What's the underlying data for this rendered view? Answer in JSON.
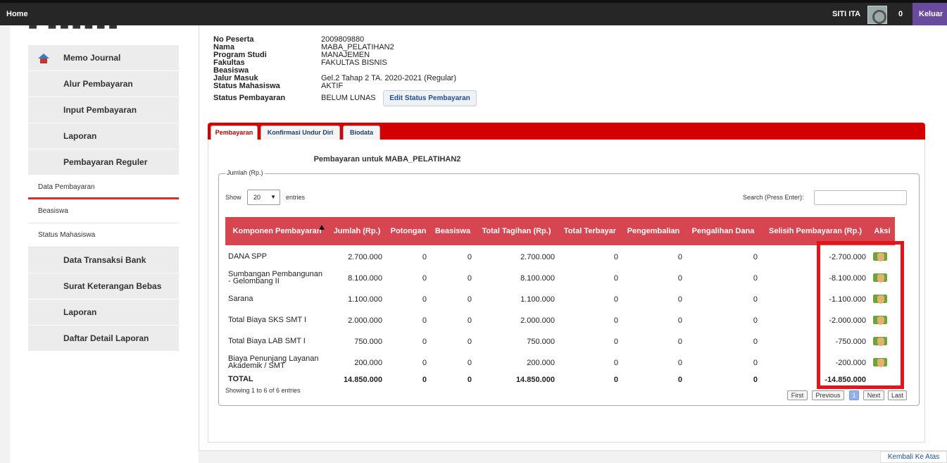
{
  "topbar": {
    "home": "Home",
    "user": "SITI ITA",
    "notif_count": "0",
    "logout": "Keluar"
  },
  "menu": {
    "items": [
      {
        "label": "Memo Journal",
        "icon": "home-icon",
        "type": "main"
      },
      {
        "label": "Alur Pembayaran",
        "type": "main"
      },
      {
        "label": "Input Pembayaran",
        "type": "main"
      },
      {
        "label": "Laporan",
        "type": "main"
      },
      {
        "label": "Pembayaran Reguler",
        "type": "main"
      },
      {
        "label": "Data Pembayaran",
        "type": "sub",
        "active": true
      },
      {
        "label": "Beasiswa",
        "type": "sub"
      },
      {
        "label": "Status Mahasiswa",
        "type": "sub"
      },
      {
        "label": "Data Transaksi Bank",
        "type": "main"
      },
      {
        "label": "Surat Keterangan Bebas",
        "type": "main"
      },
      {
        "label": "Laporan",
        "type": "main"
      },
      {
        "label": "Daftar Detail Laporan",
        "type": "main"
      }
    ]
  },
  "student": {
    "labels": [
      "No Peserta",
      "Nama",
      "Program Studi",
      "Fakultas",
      "Beasiswa",
      "Jalur Masuk",
      "Status Mahasiswa"
    ],
    "values": [
      "2009809880",
      "MABA_PELATIHAN2",
      "MANAJEMEN",
      "FAKULTAS BISNIS",
      "",
      "Gel.2 Tahap 2 TA. 2020-2021 (Regular)",
      "AKTIF"
    ],
    "status_label": "Status Pembayaran",
    "status_value": "BELUM LUNAS",
    "edit_button": "Edit Status Pembayaran"
  },
  "tabs": [
    "Pembayaran",
    "Konfirmasi Undur Diri",
    "Biodata"
  ],
  "panel": {
    "title": "Pembayaran untuk MABA_PELATIHAN2",
    "legend": "Jumlah (Rp.)",
    "show": "Show",
    "page_size": "20",
    "entries": "entries",
    "search_label": "Search (Press Enter):"
  },
  "table": {
    "headers": [
      "Komponen Pembayaran",
      "Jumlah (Rp.)",
      "Potongan",
      "Beasiswa",
      "Total Tagihan (Rp.)",
      "Total Terbayar",
      "Pengembalian",
      "Pengalihan Dana",
      "Selisih Pembayaran (Rp.)",
      "Aksi"
    ],
    "rows": [
      [
        "DANA SPP",
        "2.700.000",
        "0",
        "0",
        "2.700.000",
        "0",
        "0",
        "0",
        "-2.700.000"
      ],
      [
        "Sumbangan Pembangunan - Gelombang II",
        "8.100.000",
        "0",
        "0",
        "8.100.000",
        "0",
        "0",
        "0",
        "-8.100.000"
      ],
      [
        "Sarana",
        "1.100.000",
        "0",
        "0",
        "1.100.000",
        "0",
        "0",
        "0",
        "-1.100.000"
      ],
      [
        "Total Biaya SKS SMT I",
        "2.000.000",
        "0",
        "0",
        "2.000.000",
        "0",
        "0",
        "0",
        "-2.000.000"
      ],
      [
        "Total Biaya LAB SMT I",
        "750.000",
        "0",
        "0",
        "750.000",
        "0",
        "0",
        "0",
        "-750.000"
      ],
      [
        "Biaya Penunjang Layanan Akademik / SMT",
        "200.000",
        "0",
        "0",
        "200.000",
        "0",
        "0",
        "0",
        "-200.000"
      ]
    ],
    "total": [
      "TOTAL",
      "14.850.000",
      "0",
      "0",
      "14.850.000",
      "0",
      "0",
      "0",
      "-14.850.000"
    ],
    "action_icon": "hand-pay-icon"
  },
  "footer": {
    "showing": "Showing 1 to 6 of 6 entries",
    "pager": [
      "First",
      "Previous",
      "1",
      "Next",
      "Last"
    ],
    "back_top": "Kembali Ke Atas"
  },
  "colors": {
    "accent": "#d40000",
    "header": "#d64550",
    "logout": "#6a4a9c",
    "highlight": "#e8131a"
  }
}
